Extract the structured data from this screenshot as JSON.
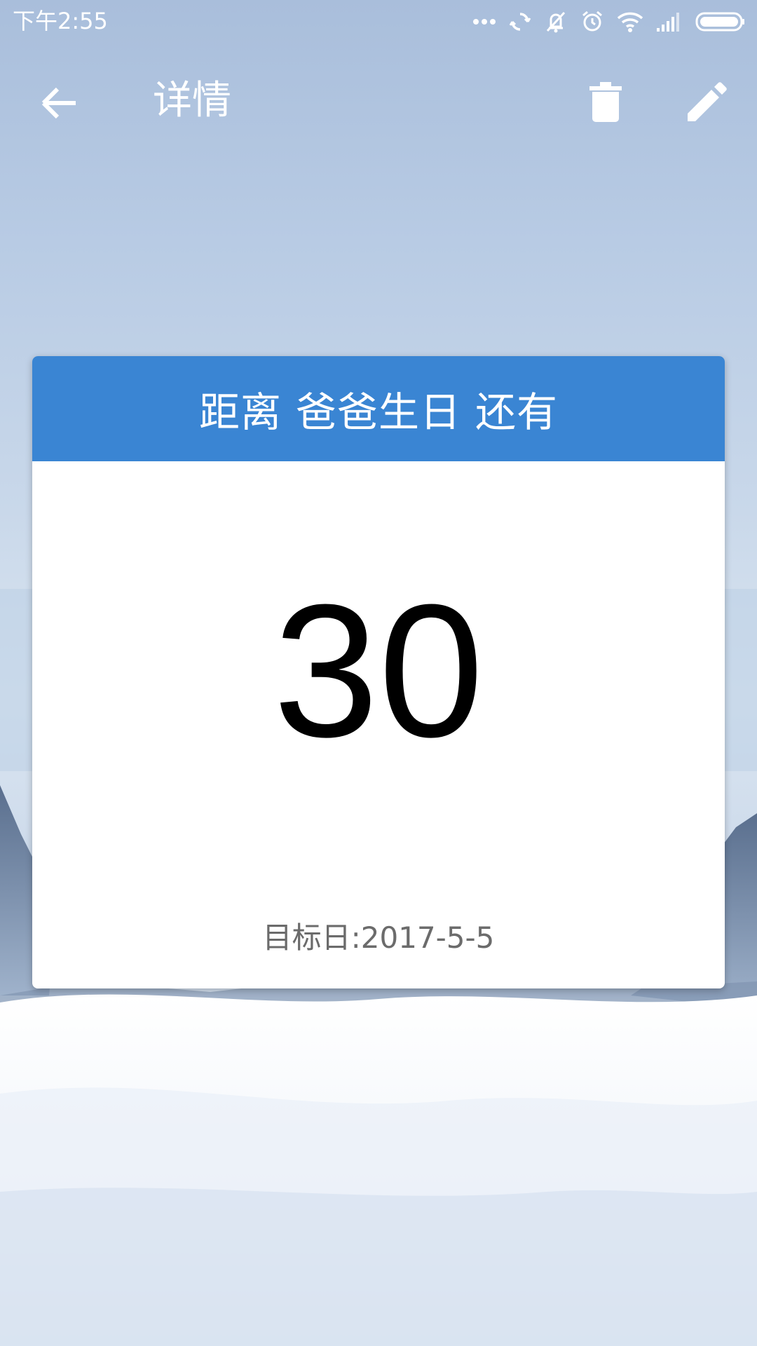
{
  "status_bar": {
    "time": "下午2:55",
    "icons": [
      "more-dots-icon",
      "sync-icon",
      "vibrate-icon",
      "alarm-icon",
      "wifi-icon",
      "signal-icon",
      "battery-icon"
    ]
  },
  "app_bar": {
    "title": "详情",
    "back_icon": "arrow-left-icon",
    "delete_icon": "trash-icon",
    "edit_icon": "pencil-icon"
  },
  "card": {
    "header": {
      "prefix": "距离",
      "event": "爸爸生日",
      "suffix": "还有"
    },
    "days": "30",
    "target_label": "目标日:",
    "target_date": "2017-5-5"
  },
  "colors": {
    "header_blue": "#3a85d3",
    "number": "#000000",
    "footer_text": "#6b6b6b"
  }
}
